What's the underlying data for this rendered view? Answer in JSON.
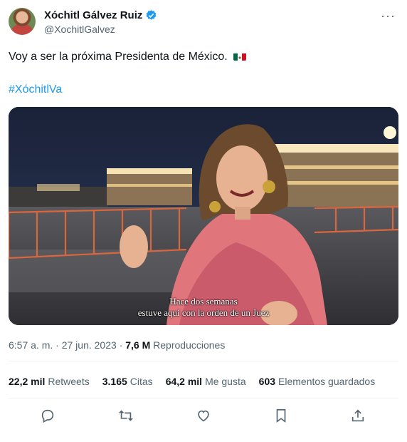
{
  "user": {
    "display_name": "Xóchitl Gálvez Ruiz",
    "handle": "@XochitlGalvez",
    "verified": true
  },
  "header": {
    "more_label": "···"
  },
  "tweet": {
    "text": "Voy a ser la próxima Presidenta de México.",
    "flag": "mexico-flag",
    "hashtag": "#XóchitlVa"
  },
  "video": {
    "subtitle_line1": "Hace dos semanas",
    "subtitle_line2": "estuve aquí con la orden de un Juez"
  },
  "meta": {
    "time": "6:57 a. m.",
    "separator": "·",
    "date": "27 jun. 2023",
    "views_count": "7,6 M",
    "views_label": "Reproducciones"
  },
  "stats": [
    {
      "count": "22,2 mil",
      "label": "Retweets"
    },
    {
      "count": "3.165",
      "label": "Citas"
    },
    {
      "count": "64,2 mil",
      "label": "Me gusta"
    },
    {
      "count": "603",
      "label": "Elementos guardados"
    }
  ],
  "actions": [
    "reply-icon",
    "retweet-icon",
    "like-icon",
    "bookmark-icon",
    "share-icon"
  ],
  "colors": {
    "accent": "#1d9bf0",
    "text": "#0f1419",
    "muted": "#536471"
  }
}
